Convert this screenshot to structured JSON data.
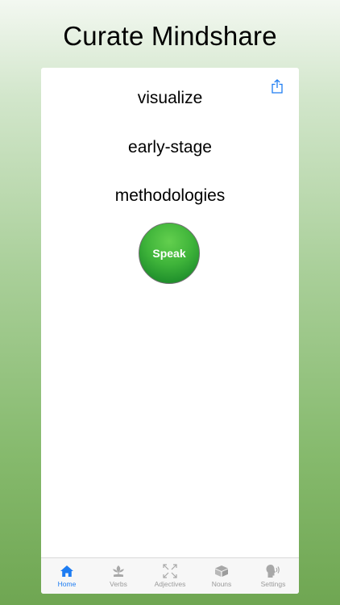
{
  "header": {
    "title": "Curate Mindshare"
  },
  "words": [
    "visualize",
    "early-stage",
    "methodologies"
  ],
  "speak_button": {
    "label": "Speak"
  },
  "share_icon": "share-icon",
  "tabs": [
    {
      "label": "Home",
      "icon": "home-icon",
      "active": true
    },
    {
      "label": "Verbs",
      "icon": "plant-icon",
      "active": false
    },
    {
      "label": "Adjectives",
      "icon": "expand-arrows-icon",
      "active": false
    },
    {
      "label": "Nouns",
      "icon": "box-icon",
      "active": false
    },
    {
      "label": "Settings",
      "icon": "speaking-head-icon",
      "active": false
    }
  ],
  "colors": {
    "accent": "#1d7cf2",
    "inactive": "#9a9a9a",
    "speak_green": "#3fb43a"
  }
}
